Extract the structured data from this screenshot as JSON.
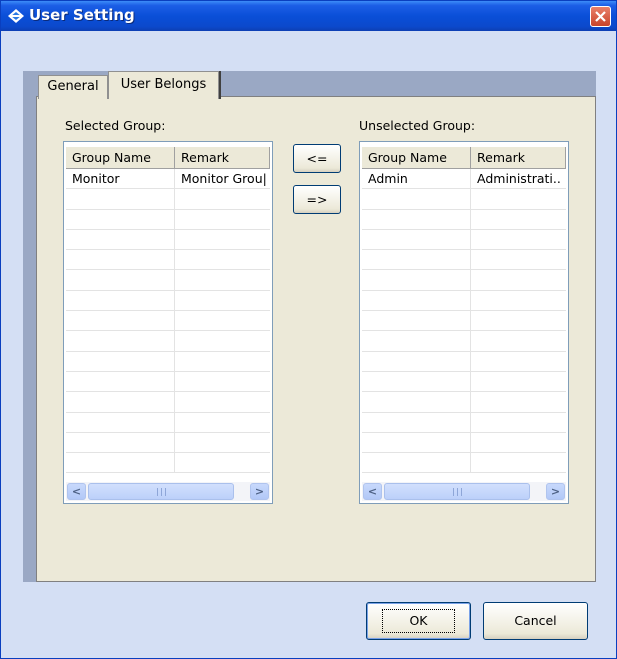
{
  "window": {
    "title": "User Setting"
  },
  "tabs": [
    {
      "label": "General",
      "selected": false
    },
    {
      "label": "User Belongs",
      "selected": true
    }
  ],
  "selected_group": {
    "label": "Selected Group:",
    "columns": [
      "Group Name",
      "Remark"
    ],
    "rows": [
      {
        "name": "Monitor",
        "remark": "Monitor Grou|"
      }
    ]
  },
  "unselected_group": {
    "label": "Unselected Group:",
    "columns": [
      "Group Name",
      "Remark"
    ],
    "rows": [
      {
        "name": "Admin",
        "remark": "Administrati.."
      }
    ]
  },
  "move_buttons": {
    "add_label": "<=",
    "remove_label": "=>"
  },
  "footer": {
    "ok_label": "OK",
    "cancel_label": "Cancel"
  },
  "scrollbar_glyphs": {
    "left": "<",
    "right": ">"
  },
  "colors": {
    "title_bar": "#0a4fd8",
    "close_button": "#c9442a",
    "dialog_background": "#d4dff4",
    "panel_background": "#ece9d8",
    "frame": "#9aa8c4"
  }
}
